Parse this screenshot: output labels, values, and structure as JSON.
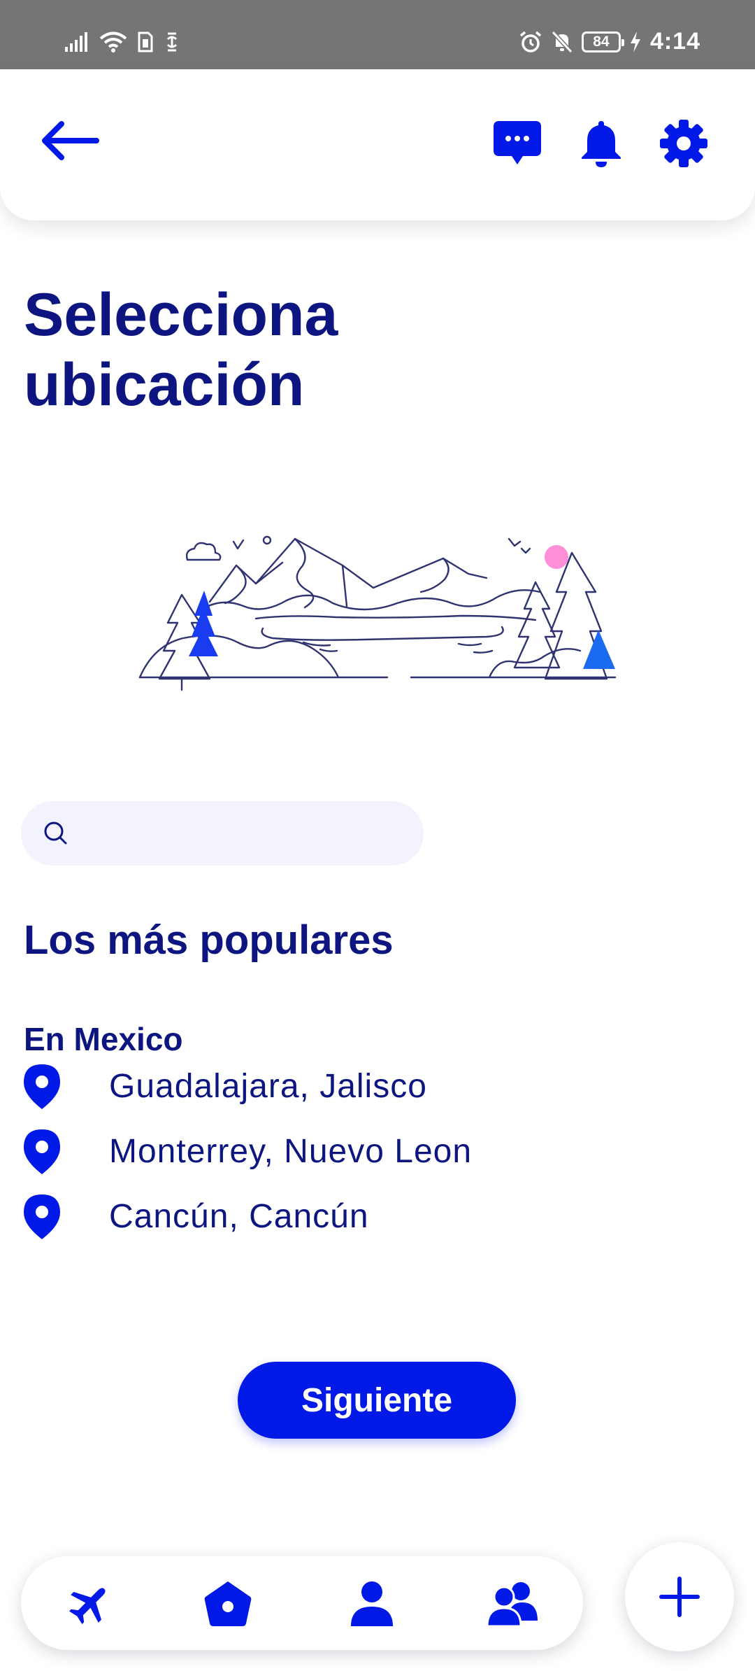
{
  "status_bar": {
    "time": "4:14",
    "battery": "84",
    "left_icons": [
      "signal-icon",
      "wifi-icon",
      "sim-icon",
      "data-saver-icon"
    ],
    "right_icons": [
      "alarm-icon",
      "mute-icon",
      "battery-icon",
      "charging-icon"
    ]
  },
  "header": {
    "icons": [
      "back-arrow-icon",
      "chat-icon",
      "bell-icon",
      "gear-icon"
    ]
  },
  "page": {
    "title_line1": "Selecciona",
    "title_line2": "ubicación"
  },
  "search": {
    "value": "",
    "placeholder": ""
  },
  "popular": {
    "title": "Los más populares",
    "country": "En Mexico",
    "locations": [
      {
        "label": "Guadalajara, Jalisco"
      },
      {
        "label": "Monterrey, Nuevo Leon"
      },
      {
        "label": "Cancún, Cancún"
      }
    ]
  },
  "actions": {
    "next_label": "Siguiente"
  },
  "bottom_nav": {
    "items": [
      "airplane-icon",
      "home-icon",
      "profile-icon",
      "group-icon"
    ],
    "fab_icon": "plus-icon"
  },
  "colors": {
    "primary": "#0019e6",
    "text": "#0d1680",
    "search_bg": "#f2f3fc",
    "status_bar": "#757575",
    "illustration_sun": "#ff8fd6"
  }
}
